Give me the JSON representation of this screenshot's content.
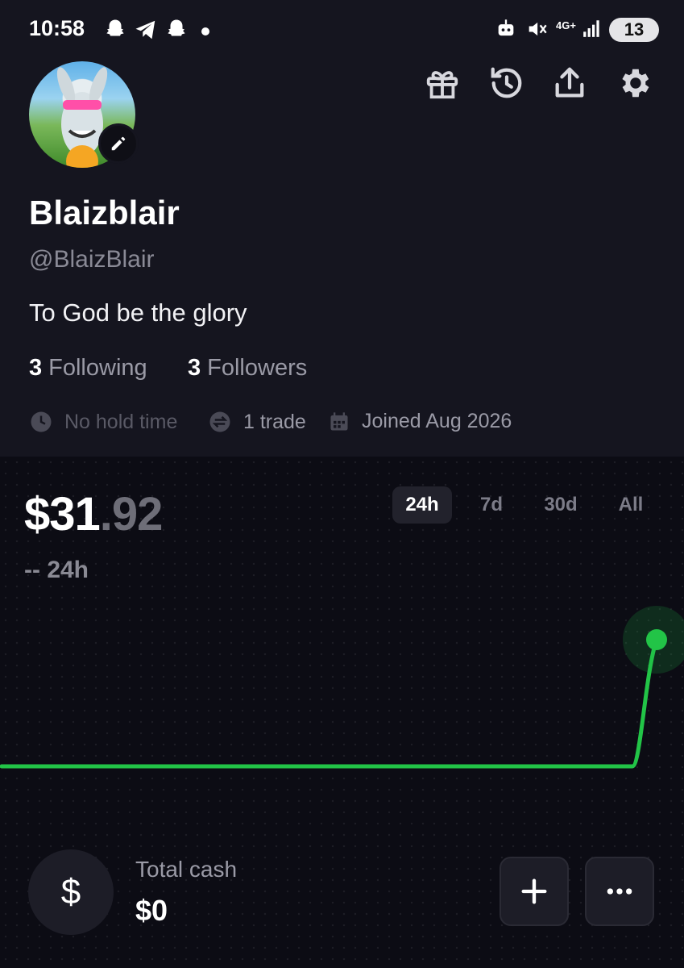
{
  "status_bar": {
    "time": "10:58",
    "battery": "13",
    "network": "4G+"
  },
  "profile": {
    "display_name": "Blaizblair",
    "handle": "@BlaizBlair",
    "bio": "To God be the glory",
    "following_count": "3",
    "following_label": "Following",
    "followers_count": "3",
    "followers_label": "Followers",
    "hold_time": "No hold time",
    "trades": "1 trade",
    "joined": "Joined Aug 2026"
  },
  "header_icons": [
    "gift-icon",
    "history-icon",
    "share-icon",
    "settings-icon"
  ],
  "portfolio": {
    "value_whole": "$31",
    "value_cents": ".92",
    "change": "-- 24h",
    "ranges": [
      "24h",
      "7d",
      "30d",
      "All"
    ],
    "selected_range": "24h"
  },
  "chart_data": {
    "type": "line",
    "series": [
      {
        "values": [
          0,
          0,
          0,
          0,
          0,
          0,
          0,
          0,
          0,
          0,
          1
        ]
      }
    ],
    "color": "#22c447"
  },
  "cash": {
    "icon": "$",
    "label": "Total cash",
    "value": "$0"
  },
  "actions": [
    "add-icon",
    "more-icon"
  ]
}
